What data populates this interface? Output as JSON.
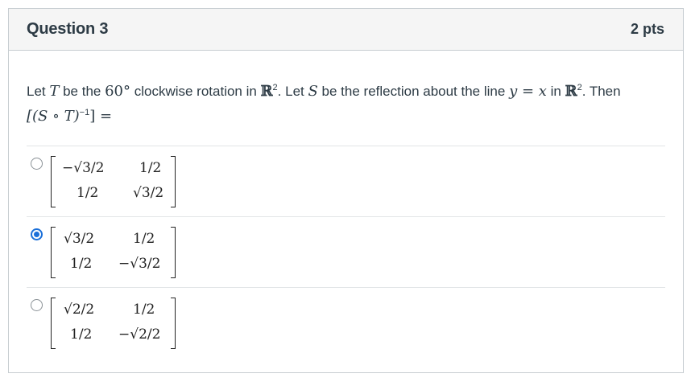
{
  "question": {
    "title": "Question 3",
    "points": "2 pts"
  },
  "stem": {
    "t1": "Let ",
    "T": "T",
    "t2": " be the ",
    "angle": "60°",
    "t3": " clockwise rotation in ",
    "R": "ℝ",
    "exp2": "2",
    "t4": ".  Let ",
    "S": "S",
    "t5": " be the reflection about the line ",
    "line_eq": "y = x",
    "t6": " in ",
    "t7": ". Then",
    "expr": "[(S ∘ T)",
    "expr_exp": "−1",
    "expr_end": "] ="
  },
  "answers": [
    {
      "selected": false,
      "m11": "−√3/2",
      "m12": "1/2",
      "m21": "1/2",
      "m22": "√3/2"
    },
    {
      "selected": true,
      "m11": "√3/2",
      "m12": "1/2",
      "m21": "1/2",
      "m22": "−√3/2"
    },
    {
      "selected": false,
      "m11": "√2/2",
      "m12": "1/2",
      "m21": "1/2",
      "m22": "−√2/2"
    }
  ]
}
